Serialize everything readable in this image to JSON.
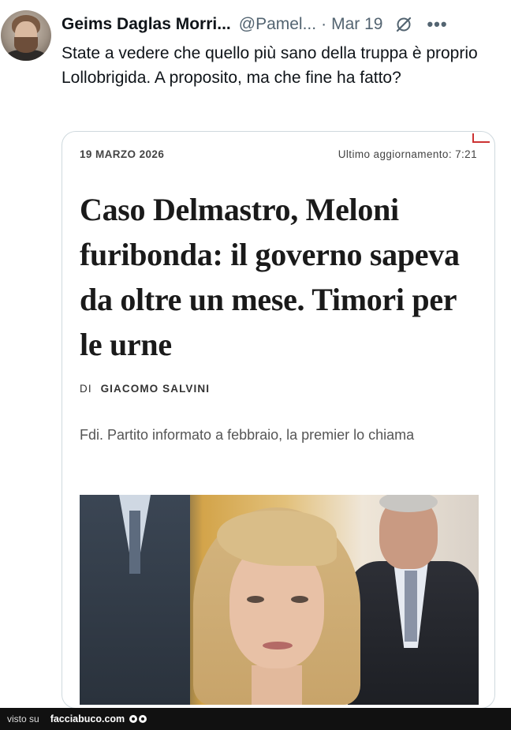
{
  "tweet": {
    "author_name": "Geims Daglas Morri...",
    "handle": "@Pamel...",
    "separator": "·",
    "date": "Mar 19",
    "text": "State a vedere che quello più sano della truppa è proprio Lollobrigida. A proposito, ma che fine ha fatto?",
    "icons": [
      "grok-icon",
      "more-icon"
    ]
  },
  "article": {
    "date": "19 MARZO 2026",
    "updated": "Ultimo aggiornamento: 7:21",
    "headline": "Caso Delmastro, Meloni furibonda: il governo sapeva da oltre un mese. Timori per le urne",
    "byline_prefix": "DI",
    "byline_name": "GIACOMO SALVINI",
    "subhead": "Fdi. Partito informato a febbraio, la premier lo chiama"
  },
  "footer": {
    "visto": "visto su",
    "brand": "facciabuco.com"
  },
  "colors": {
    "text": "#0f1419",
    "secondary": "#536471",
    "border": "#cfd9de",
    "footer_bg": "#111111"
  }
}
